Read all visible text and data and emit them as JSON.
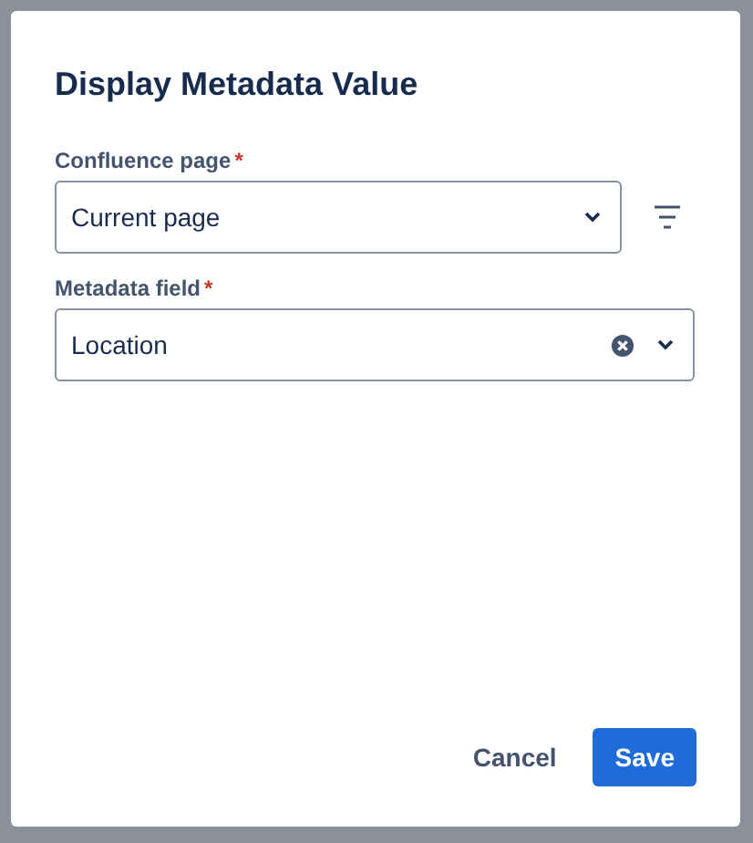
{
  "dialog": {
    "title": "Display Metadata Value"
  },
  "fields": [
    {
      "label": "Confluence page",
      "required_mark": "*",
      "value": "Current page",
      "clearable": false,
      "filter_button": true
    },
    {
      "label": "Metadata field",
      "required_mark": "*",
      "value": "Location",
      "clearable": true,
      "filter_button": false
    }
  ],
  "buttons": [
    {
      "label": "Cancel",
      "kind": "subtle"
    },
    {
      "label": "Save",
      "kind": "primary"
    }
  ]
}
